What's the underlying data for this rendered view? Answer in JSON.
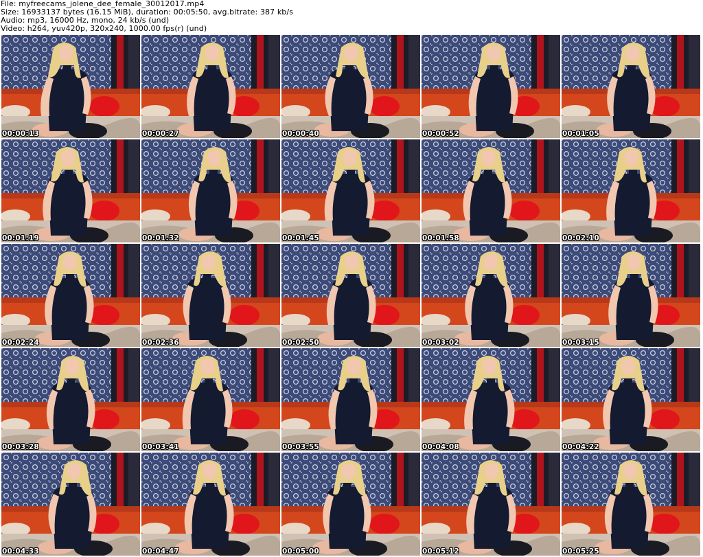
{
  "header": {
    "file_line": "File: myfreecams_jolene_dee_female_30012017.mp4",
    "size_line": "Size: 16933137 bytes (16.15 MiB), duration: 00:05:50, avg.bitrate: 387 kb/s",
    "audio_line": "Audio: mp3, 16000 Hz, mono, 24 kb/s (und)",
    "video_line": "Video: h264, yuv420p, 320x240, 1000.00 fps(r) (und)"
  },
  "thumbnails": [
    {
      "timestamp": "00:00:13"
    },
    {
      "timestamp": "00:00:27"
    },
    {
      "timestamp": "00:00:40"
    },
    {
      "timestamp": "00:00:52"
    },
    {
      "timestamp": "00:01:05"
    },
    {
      "timestamp": "00:01:19"
    },
    {
      "timestamp": "00:01:32"
    },
    {
      "timestamp": "00:01:45"
    },
    {
      "timestamp": "00:01:58"
    },
    {
      "timestamp": "00:02:10"
    },
    {
      "timestamp": "00:02:24"
    },
    {
      "timestamp": "00:02:36"
    },
    {
      "timestamp": "00:02:50"
    },
    {
      "timestamp": "00:03:02"
    },
    {
      "timestamp": "00:03:15"
    },
    {
      "timestamp": "00:03:28"
    },
    {
      "timestamp": "00:03:41"
    },
    {
      "timestamp": "00:03:55"
    },
    {
      "timestamp": "00:04:08"
    },
    {
      "timestamp": "00:04:22"
    },
    {
      "timestamp": "00:04:33"
    },
    {
      "timestamp": "00:04:47"
    },
    {
      "timestamp": "00:05:00"
    },
    {
      "timestamp": "00:05:12"
    },
    {
      "timestamp": "00:05:25"
    }
  ],
  "colors": {
    "curtain": "#3c4a78",
    "curtain_pattern": "#c9cde0",
    "red_wall": "#c0141c",
    "sofa": "#d4461c",
    "pillow": "#e0161a",
    "dress": "#141a30",
    "hair": "#e8d08a",
    "skin": "#f1c7b0",
    "floor": "#cfc2b4"
  }
}
